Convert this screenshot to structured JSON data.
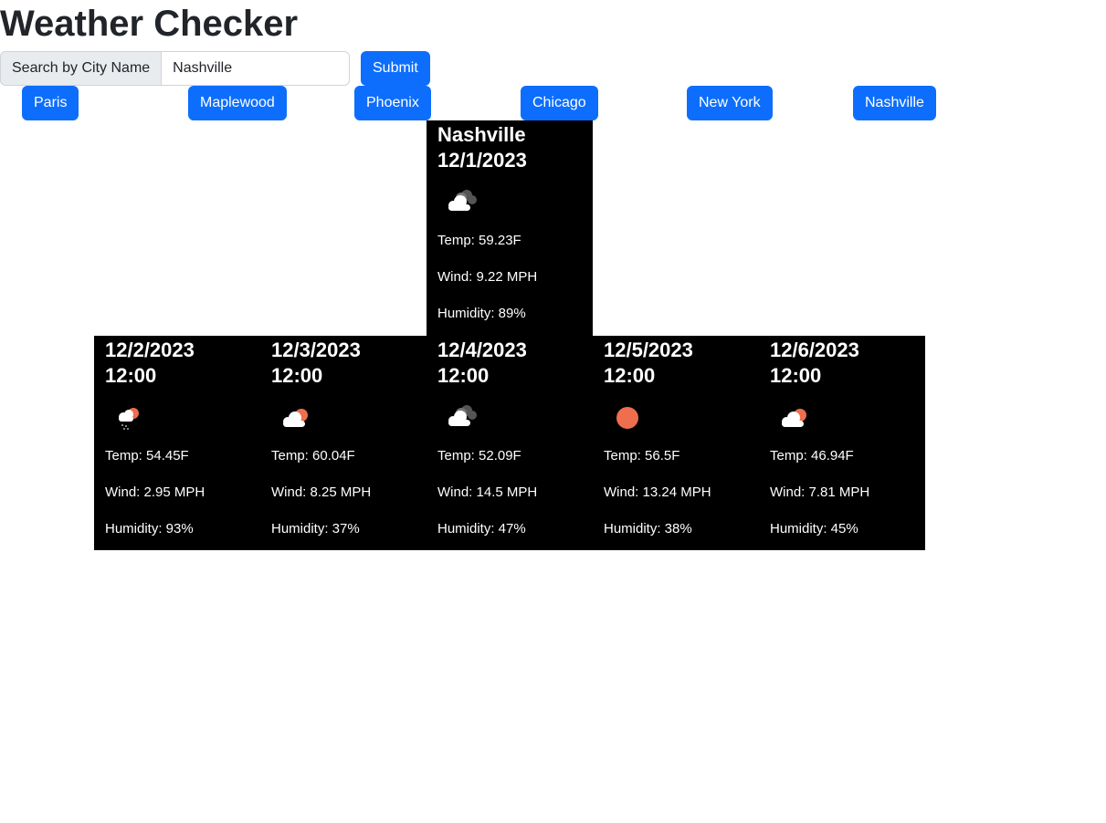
{
  "app": {
    "title": "Weather Checker"
  },
  "search": {
    "label": "Search by City Name",
    "value": "Nashville",
    "placeholder": "",
    "submit_label": "Submit"
  },
  "history": [
    {
      "label": "Paris"
    },
    {
      "label": "Maplewood"
    },
    {
      "label": "Phoenix"
    },
    {
      "label": "Chicago"
    },
    {
      "label": "New York"
    },
    {
      "label": "Nashville"
    }
  ],
  "current": {
    "city": "Nashville",
    "date": "12/1/2023",
    "icon": "broken-clouds-icon",
    "temp": "Temp: 59.23F",
    "wind": "Wind: 9.22 MPH",
    "humidity": "Humidity: 89%"
  },
  "forecast": [
    {
      "date": "12/2/2023",
      "time": "12:00",
      "icon": "rain-icon",
      "temp": "Temp: 54.45F",
      "wind": "Wind: 2.95 MPH",
      "humidity": "Humidity: 93%"
    },
    {
      "date": "12/3/2023",
      "time": "12:00",
      "icon": "partly-cloudy-icon",
      "temp": "Temp: 60.04F",
      "wind": "Wind: 8.25 MPH",
      "humidity": "Humidity: 37%"
    },
    {
      "date": "12/4/2023",
      "time": "12:00",
      "icon": "broken-clouds-icon",
      "temp": "Temp: 52.09F",
      "wind": "Wind: 14.5 MPH",
      "humidity": "Humidity: 47%"
    },
    {
      "date": "12/5/2023",
      "time": "12:00",
      "icon": "clear-sun-icon",
      "temp": "Temp: 56.5F",
      "wind": "Wind: 13.24 MPH",
      "humidity": "Humidity: 38%"
    },
    {
      "date": "12/6/2023",
      "time": "12:00",
      "icon": "partly-cloudy-icon",
      "temp": "Temp: 46.94F",
      "wind": "Wind: 7.81 MPH",
      "humidity": "Humidity: 45%"
    }
  ],
  "colors": {
    "accent": "#0d6efd",
    "card_bg": "#000000",
    "sun": "#ee6e4d",
    "cloud": "#ffffff",
    "dark_cloud": "#555555"
  }
}
